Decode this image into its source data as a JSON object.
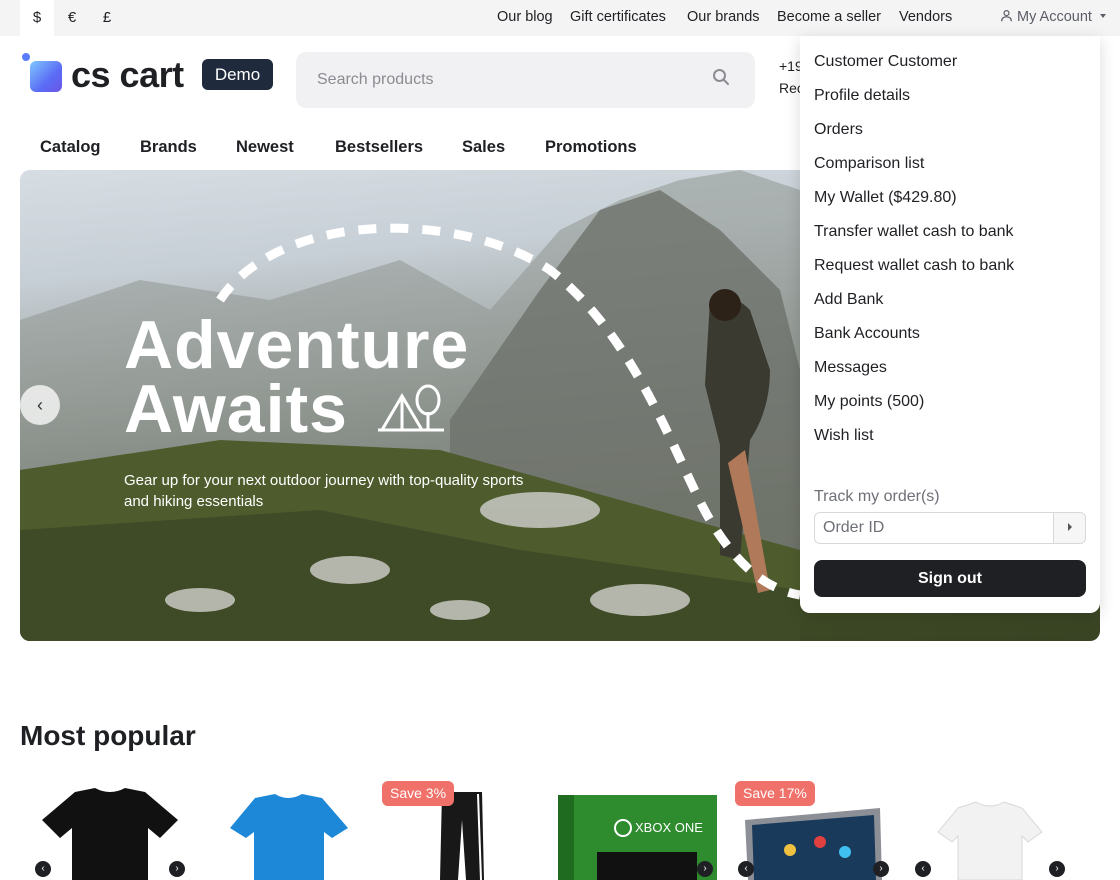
{
  "top_bar": {
    "currencies": [
      "$",
      "€",
      "£"
    ],
    "selected_currency": "$",
    "links": [
      "Our blog",
      "Gift certificates",
      "Our brands",
      "Become a seller",
      "Vendors"
    ],
    "account_label": "My Account"
  },
  "header": {
    "logo_text": "cs cart",
    "demo_badge": "Demo",
    "search_placeholder": "Search products",
    "phone_partial": "+19",
    "phone_sub_partial": "Rec"
  },
  "nav": [
    "Catalog",
    "Brands",
    "Newest",
    "Bestsellers",
    "Sales",
    "Promotions"
  ],
  "hero": {
    "title_line1": "Adventure",
    "title_line2": "Awaits",
    "subtitle": "Gear up for your next outdoor journey with top-quality sports and hiking essentials",
    "prev_arrow": "‹"
  },
  "account_menu": {
    "items": [
      "Customer Customer",
      "Profile details",
      "Orders",
      "Comparison list",
      "My Wallet ($429.80)",
      "Transfer wallet cash to bank",
      "Request wallet cash to bank",
      "Add Bank",
      "Bank Accounts",
      "Messages",
      "My points (500)",
      "Wish list"
    ],
    "track_label": "Track my order(s)",
    "order_id_placeholder": "Order ID",
    "sign_out": "Sign out"
  },
  "most_popular": {
    "title": "Most popular",
    "badges": [
      "Save 3%",
      "Save 17%"
    ],
    "xbox_label": "XBOX ONE"
  },
  "colors": {
    "dark": "#1f2024",
    "badge": "#f0706a",
    "demo_bg": "#1f2a3c",
    "top_bar_bg": "#f4f4f5"
  }
}
